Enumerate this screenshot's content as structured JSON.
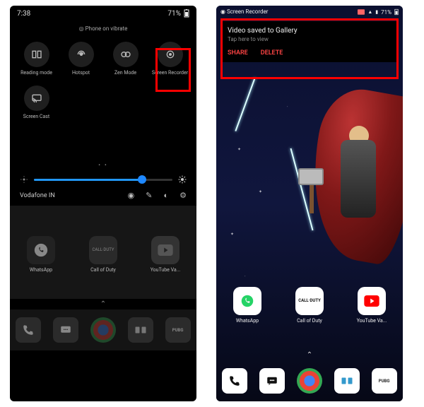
{
  "left": {
    "status": {
      "time": "7:38",
      "battery": "71%"
    },
    "vibrate_text": "Phone on vibrate",
    "qs": {
      "tiles": [
        {
          "name": "reading-mode",
          "label": "Reading mode"
        },
        {
          "name": "hotspot",
          "label": "Hotspot"
        },
        {
          "name": "zen-mode",
          "label": "Zen Mode"
        },
        {
          "name": "screen-recorder",
          "label": "Screen Recorder"
        }
      ],
      "tiles2": [
        {
          "name": "screen-cast",
          "label": "Screen Cast"
        }
      ]
    },
    "carrier": "Vodafone IN",
    "apps": [
      {
        "name": "whatsapp",
        "label": "WhatsApp"
      },
      {
        "name": "call-of-duty",
        "label": "Call of Duty"
      },
      {
        "name": "youtube-vanced",
        "label": "YouTube Va..."
      }
    ],
    "dock": [
      {
        "name": "phone"
      },
      {
        "name": "messages"
      },
      {
        "name": "chrome"
      },
      {
        "name": "mx-player"
      },
      {
        "name": "pubg"
      }
    ]
  },
  "right": {
    "status": {
      "app": "Screen Recorder",
      "battery": "71%"
    },
    "notification": {
      "title": "Video saved to Gallery",
      "subtitle": "Tap here to view",
      "share": "SHARE",
      "delete": "DELETE"
    },
    "apps": [
      {
        "name": "whatsapp",
        "label": "WhatsApp"
      },
      {
        "name": "call-of-duty",
        "label": "Call of Duty"
      },
      {
        "name": "youtube-vanced",
        "label": "YouTube Va..."
      }
    ],
    "dock": [
      {
        "name": "phone"
      },
      {
        "name": "messages"
      },
      {
        "name": "chrome"
      },
      {
        "name": "mx-player"
      },
      {
        "name": "pubg"
      }
    ]
  },
  "icons": {
    "cod_text": "CALL·DUTY",
    "pubg_text": "PUBG"
  }
}
